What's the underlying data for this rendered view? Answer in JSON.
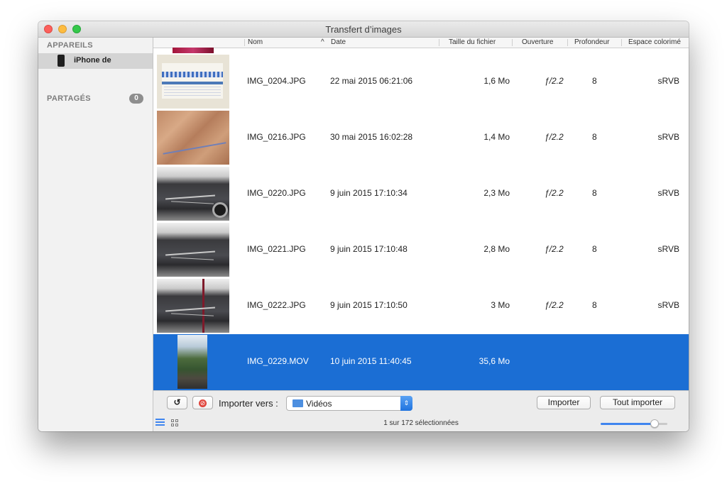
{
  "window": {
    "title": "Transfert d’images"
  },
  "sidebar": {
    "devices_heading": "APPAREILS",
    "device_name": "iPhone de",
    "shared_heading": "PARTAGÉS",
    "shared_count": "0"
  },
  "columns": {
    "name": "Nom",
    "sort_indicator": "^",
    "date": "Date",
    "size": "Taille du fichier",
    "aperture": "Ouverture",
    "depth": "Profondeur",
    "colorspace": "Espace colorimé"
  },
  "rows": [
    {
      "name": "IMG_0204.JPG",
      "date": "22 mai 2015 06:21:06",
      "size": "1,6 Mo",
      "aperture": "ƒ/2.2",
      "depth": "8",
      "colorspace": "sRVB"
    },
    {
      "name": "IMG_0216.JPG",
      "date": "30 mai 2015 16:02:28",
      "size": "1,4 Mo",
      "aperture": "ƒ/2.2",
      "depth": "8",
      "colorspace": "sRVB"
    },
    {
      "name": "IMG_0220.JPG",
      "date": "9 juin 2015 17:10:34",
      "size": "2,3 Mo",
      "aperture": "ƒ/2.2",
      "depth": "8",
      "colorspace": "sRVB"
    },
    {
      "name": "IMG_0221.JPG",
      "date": "9 juin 2015 17:10:48",
      "size": "2,8 Mo",
      "aperture": "ƒ/2.2",
      "depth": "8",
      "colorspace": "sRVB"
    },
    {
      "name": "IMG_0222.JPG",
      "date": "9 juin 2015 17:10:50",
      "size": "3 Mo",
      "aperture": "ƒ/2.2",
      "depth": "8",
      "colorspace": "sRVB"
    },
    {
      "name": "IMG_0229.MOV",
      "date": "10 juin 2015 11:40:45",
      "size": "35,6 Mo",
      "aperture": "",
      "depth": "",
      "colorspace": ""
    }
  ],
  "toolbar": {
    "rotate_glyph": "↺",
    "delete_glyph": "⊘",
    "import_to_label": "Importer vers :",
    "destination": "Vidéos",
    "import_button": "Importer",
    "import_all_button": "Tout importer"
  },
  "status": {
    "text": "1 sur 172 sélectionnées"
  },
  "thumbnail_size_slider": {
    "level": 0.85
  },
  "colors": {
    "selection": "#1b6ed4",
    "accent": "#3f85ef"
  },
  "icons": [
    "phone-icon",
    "rotate-icon",
    "delete-icon",
    "folder-icon",
    "list-view-icon",
    "grid-view-icon",
    "sidebar-toggle-icon"
  ]
}
